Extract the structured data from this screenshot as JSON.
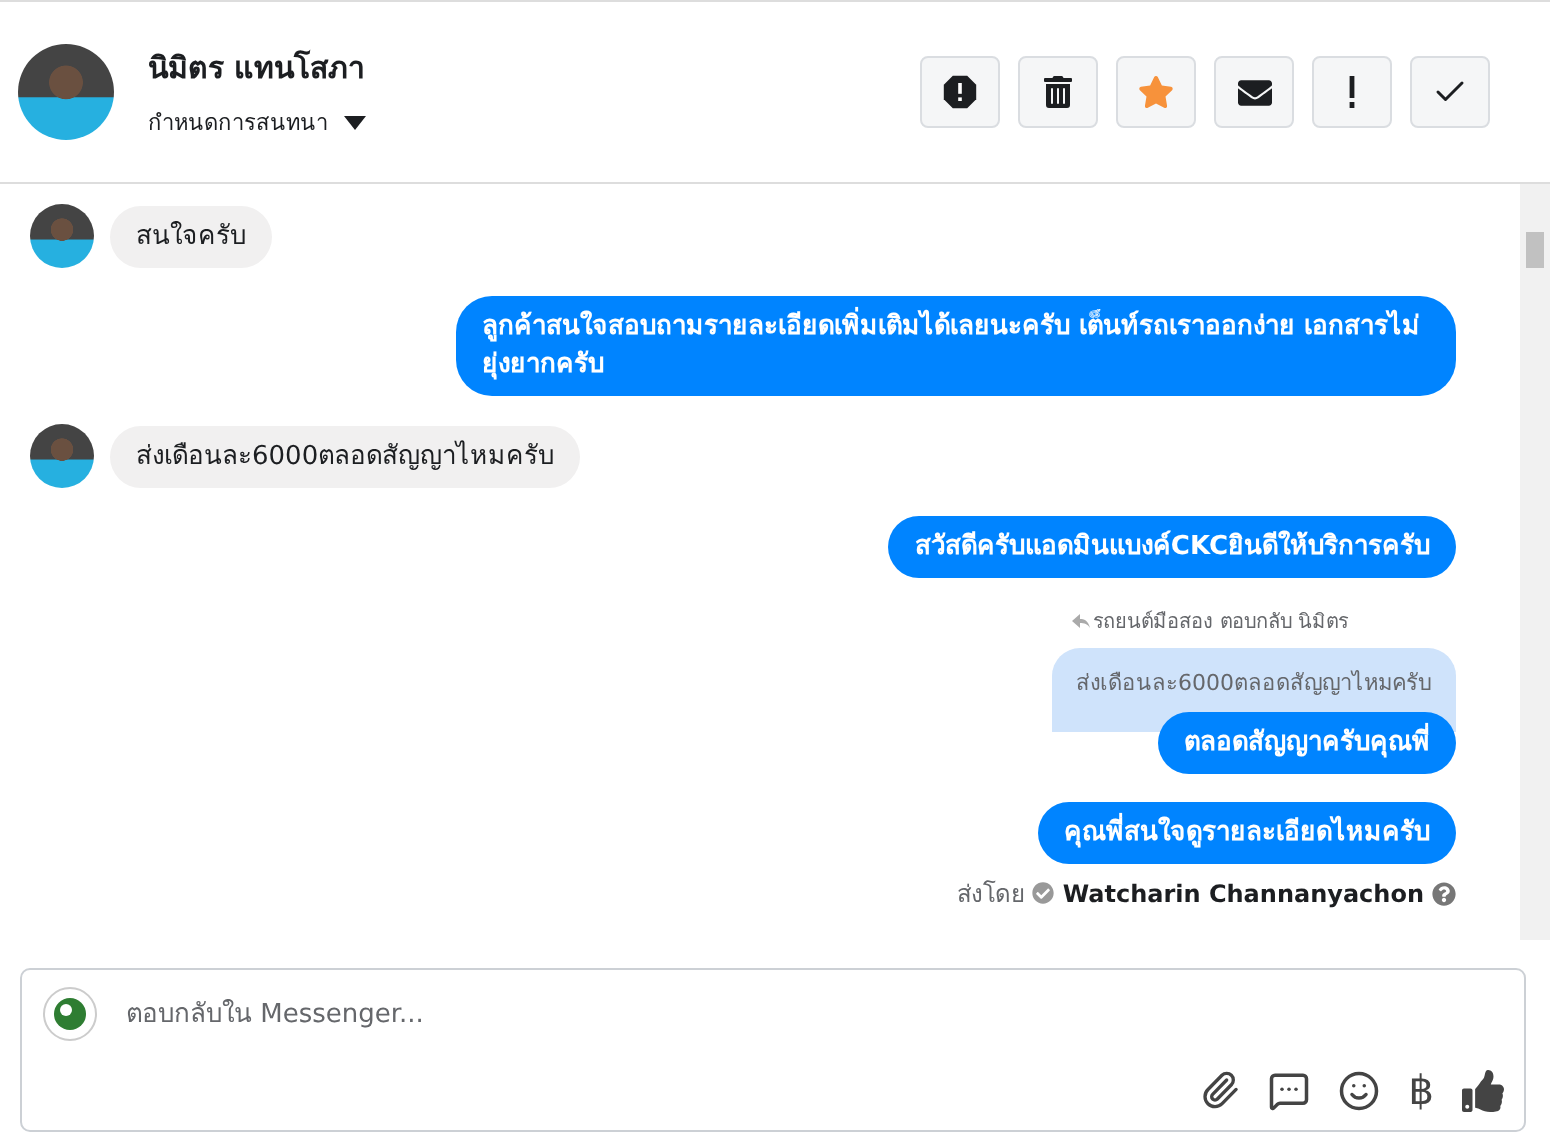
{
  "header": {
    "name": "นิมิตร แทนโสภา",
    "subtitle": "กำหนดการสนทนา",
    "starred": true
  },
  "messages": [
    {
      "kind": "incoming",
      "text": "สนใจครับ"
    },
    {
      "kind": "outgoing",
      "text": "ลูกค้าสนใจสอบถามรายละเอียดเพิ่มเติมได้เลยนะครับ เต็นท์รถเราออกง่าย เอกสารไม่ยุ่งยากครับ"
    },
    {
      "kind": "incoming",
      "text": "ส่งเดือนละ6000ตลอดสัญญาไหมครับ"
    },
    {
      "kind": "outgoing",
      "text": "สวัสดีครับแอดมินแบงค์CKCยินดีให้บริการครับ"
    },
    {
      "kind": "reply",
      "reply_label": "รถยนต์มือสอง ตอบกลับ นิมิตร",
      "quoted": "ส่งเดือนละ6000ตลอดสัญญาไหมครับ",
      "text": "ตลอดสัญญาครับคุณพี่"
    },
    {
      "kind": "outgoing",
      "text": "คุณพี่สนใจดูรายละเอียดไหมครับ"
    }
  ],
  "sent_by": {
    "label": "ส่งโดย",
    "name": "Watcharin Channanyachon"
  },
  "composer": {
    "placeholder": "ตอบกลับใน Messenger...",
    "currency": "฿"
  }
}
